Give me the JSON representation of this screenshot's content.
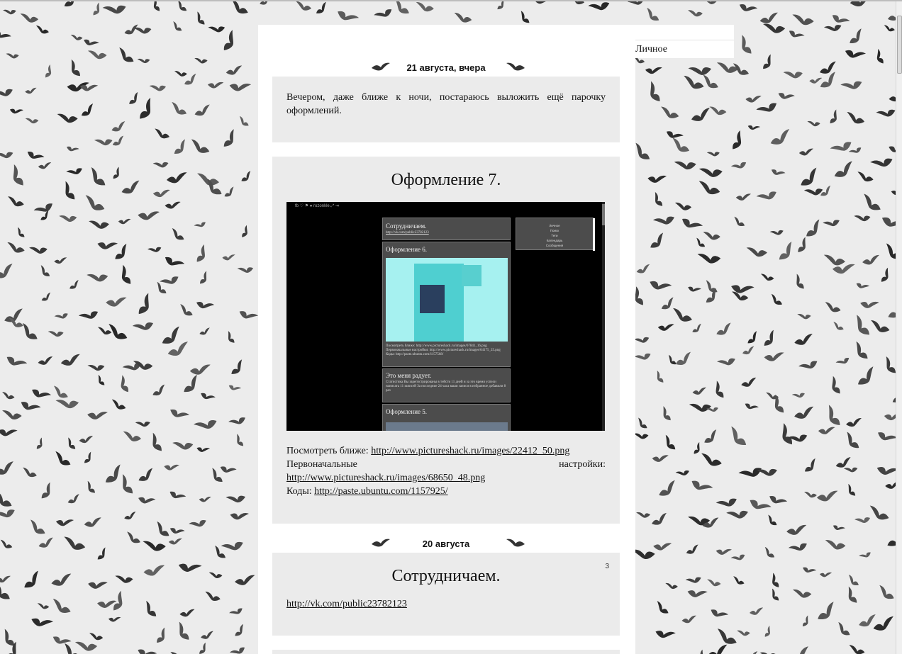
{
  "sidebar": {
    "menu_item": "Личное"
  },
  "entries": [
    {
      "date": "21 августа, вчера",
      "text": "Вечером, даже ближе к ночи, постараюсь выложить ещё парочку оформлений."
    },
    {
      "title": "Оформление 7.",
      "screenshot": {
        "toolbar": "fb  ♡  ⚑  ●  rozonkle  ⤢  ⇥",
        "posts": [
          {
            "title": "Сотрудничаем.",
            "text": "http://vk.com/public23782123"
          },
          {
            "title": "Оформление 6.",
            "text": "Посмотреть ближе: http://www.pictureshack.ru/images/67841_16.png Первоначальные настройки: http://www.pictureshack.ru/images/64175_25.png Коды: http://paste.ubuntu.com/1157568/"
          },
          {
            "title": "Это меня радует.",
            "text": "Статистика Вы зарегистрированы в тейсти 11 дней и за это время успели написать 11 записей За последние 24 часа ваши записи в избранное добавили 8 раз"
          },
          {
            "title": "Оформление 5.",
            "text": ""
          }
        ],
        "menu": [
          "Личное",
          "Поиск",
          "Теги",
          "Календарь",
          "Сообщения"
        ]
      },
      "view_label": "Посмотреть ближе:",
      "view_url": "http://www.pictureshack.ru/images/22412_50.png",
      "initial_label_1": "Первоначальные",
      "initial_label_2": "настройки:",
      "initial_url": "http://www.pictureshack.ru/images/68650_48.png",
      "codes_label": "Коды:",
      "codes_url": "http://paste.ubuntu.com/1157925/"
    },
    {
      "date": "20 августа",
      "count": "3",
      "title": "Сотрудничаем.",
      "url": "http://vk.com/public23782123"
    }
  ]
}
